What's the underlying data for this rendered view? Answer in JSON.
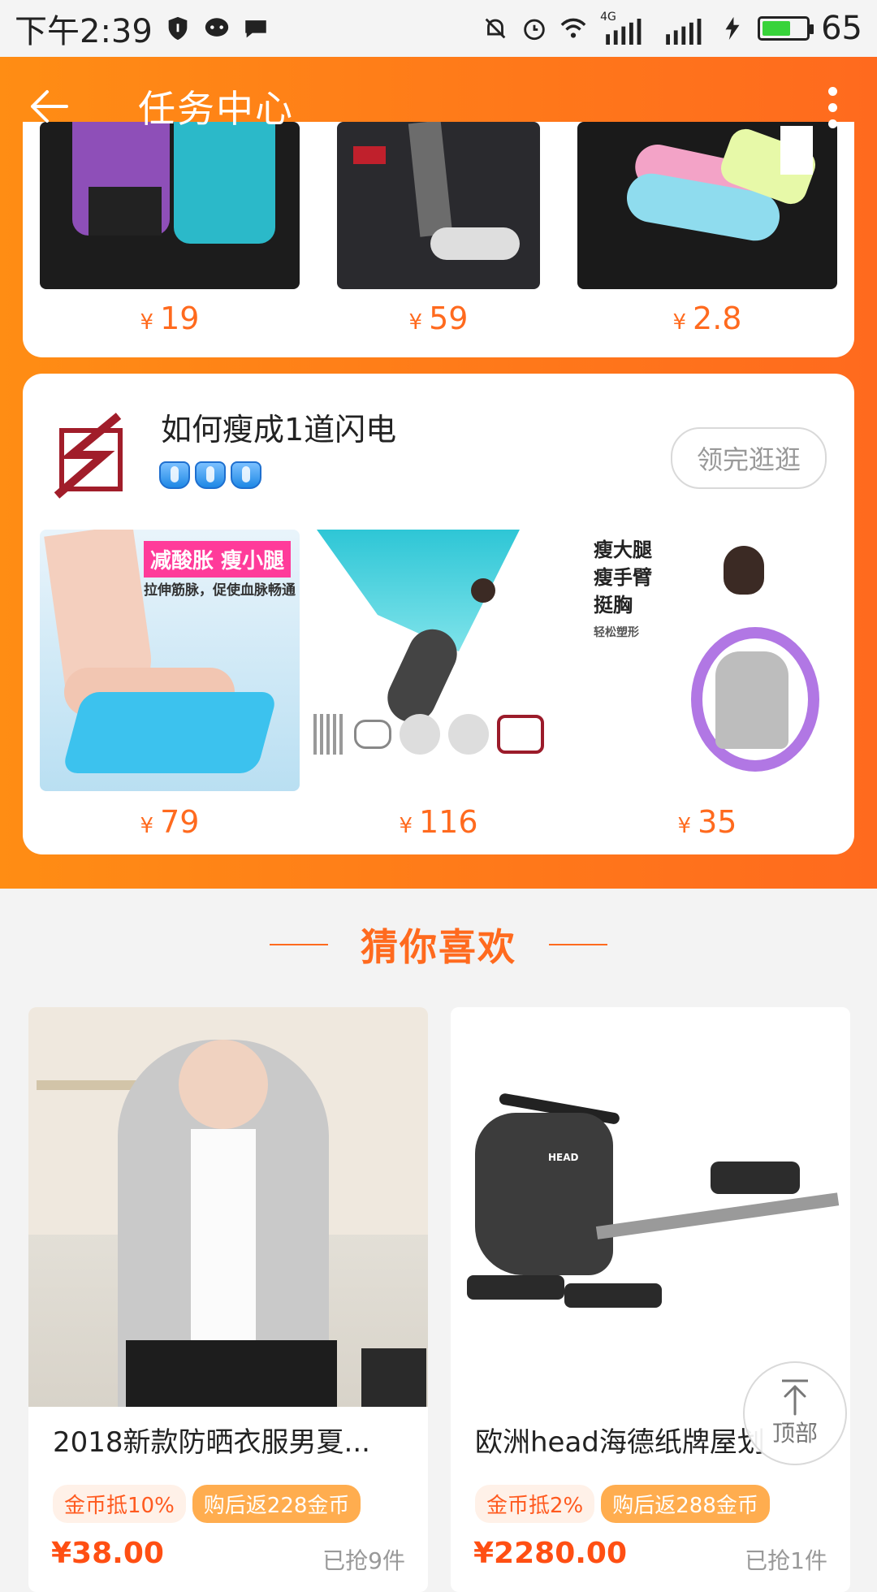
{
  "status_bar": {
    "time": "下午2:39",
    "battery": "65",
    "battery_level": 0.65,
    "net_label": "4G"
  },
  "header": {
    "title": "任务中心"
  },
  "top_card": {
    "prices": [
      {
        "symbol": "¥",
        "value": "19"
      },
      {
        "symbol": "¥",
        "value": "59"
      },
      {
        "symbol": "¥",
        "value": "2.8"
      }
    ]
  },
  "shop_card": {
    "name": "如何瘦成1道闪电",
    "visit_label": "领完逛逛",
    "promo_text": "减酸胀 瘦小腿",
    "promo_sub": "拉伸筋脉，促使血脉畅通",
    "slogans": [
      "瘦大腿",
      "瘦手臂",
      "挺胸",
      "轻松塑形"
    ],
    "prices": [
      {
        "symbol": "¥",
        "value": "79"
      },
      {
        "symbol": "¥",
        "value": "116"
      },
      {
        "symbol": "¥",
        "value": "35"
      }
    ]
  },
  "guess_section": {
    "title": "猜你喜欢"
  },
  "products": [
    {
      "name": "2018新款防晒衣服男夏...",
      "tag1": "金币抵10%",
      "tag2": "购后返228金币",
      "price": "¥38.00",
      "sold": "已抢9件"
    },
    {
      "name": "欧洲head海德纸牌屋划",
      "tag1": "金币抵2%",
      "tag2": "购后返288金币",
      "price": "¥2280.00",
      "sold": "已抢1件",
      "brand_mark": "HEAD"
    }
  ],
  "back_to_top": {
    "label": "顶部"
  },
  "colors": {
    "accent": "#ff6a1e",
    "orange_start": "#ff8d14",
    "price_red": "#ff4f13"
  }
}
